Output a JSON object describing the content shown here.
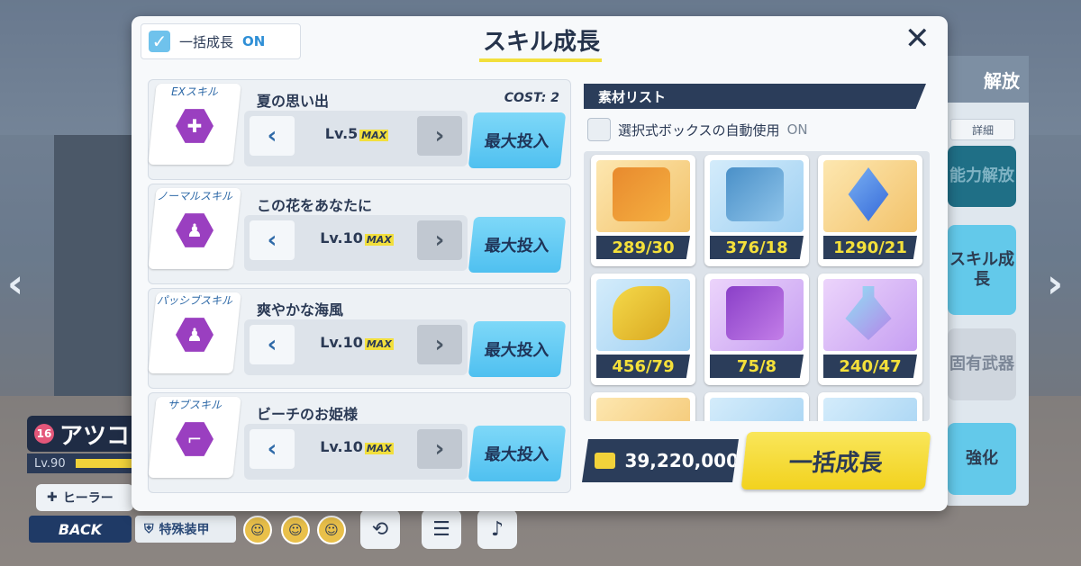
{
  "background": {
    "character": {
      "badge": "16",
      "name": "アツコ",
      "level": "Lv.90"
    },
    "role_label": "ヒーラー",
    "back_label": "BACK",
    "armor_label": "特殊装甲",
    "side_menu": {
      "header": "解放",
      "detail": "詳細",
      "items": [
        "能力解放",
        "スキル成長",
        "固有武器",
        "強化"
      ]
    }
  },
  "dialog": {
    "title": "スキル成長",
    "bulk_toggle": {
      "label": "一括成長",
      "state": "ON"
    },
    "skills": [
      {
        "type": "EXスキル",
        "name": "夏の思い出",
        "cost_label": "COST",
        "cost": "2",
        "level": "Lv.5",
        "max": "MAX",
        "button": "最大投入"
      },
      {
        "type": "ノーマルスキル",
        "name": "この花をあなたに",
        "level": "Lv.10",
        "max": "MAX",
        "button": "最大投入"
      },
      {
        "type": "パッシブスキル",
        "name": "爽やかな海風",
        "level": "Lv.10",
        "max": "MAX",
        "button": "最大投入"
      },
      {
        "type": "サブスキル",
        "name": "ビーチのお姫様",
        "level": "Lv.10",
        "max": "MAX",
        "button": "最大投入"
      }
    ],
    "materials": {
      "header": "素材リスト",
      "auto_use_label": "選択式ボックスの自動使用",
      "auto_use_state": "ON",
      "items": [
        {
          "count": "289/30"
        },
        {
          "count": "376/18"
        },
        {
          "count": "1290/21"
        },
        {
          "count": "456/79"
        },
        {
          "count": "75/8"
        },
        {
          "count": "240/47"
        }
      ]
    },
    "credits": "39,220,000",
    "bulk_button": "一括成長"
  },
  "colors": {
    "accent_blue": "#4fc0f0",
    "accent_yellow": "#f2d21e",
    "dark_navy": "#2b3d5a",
    "skill_purple": "#9a3fc0"
  }
}
